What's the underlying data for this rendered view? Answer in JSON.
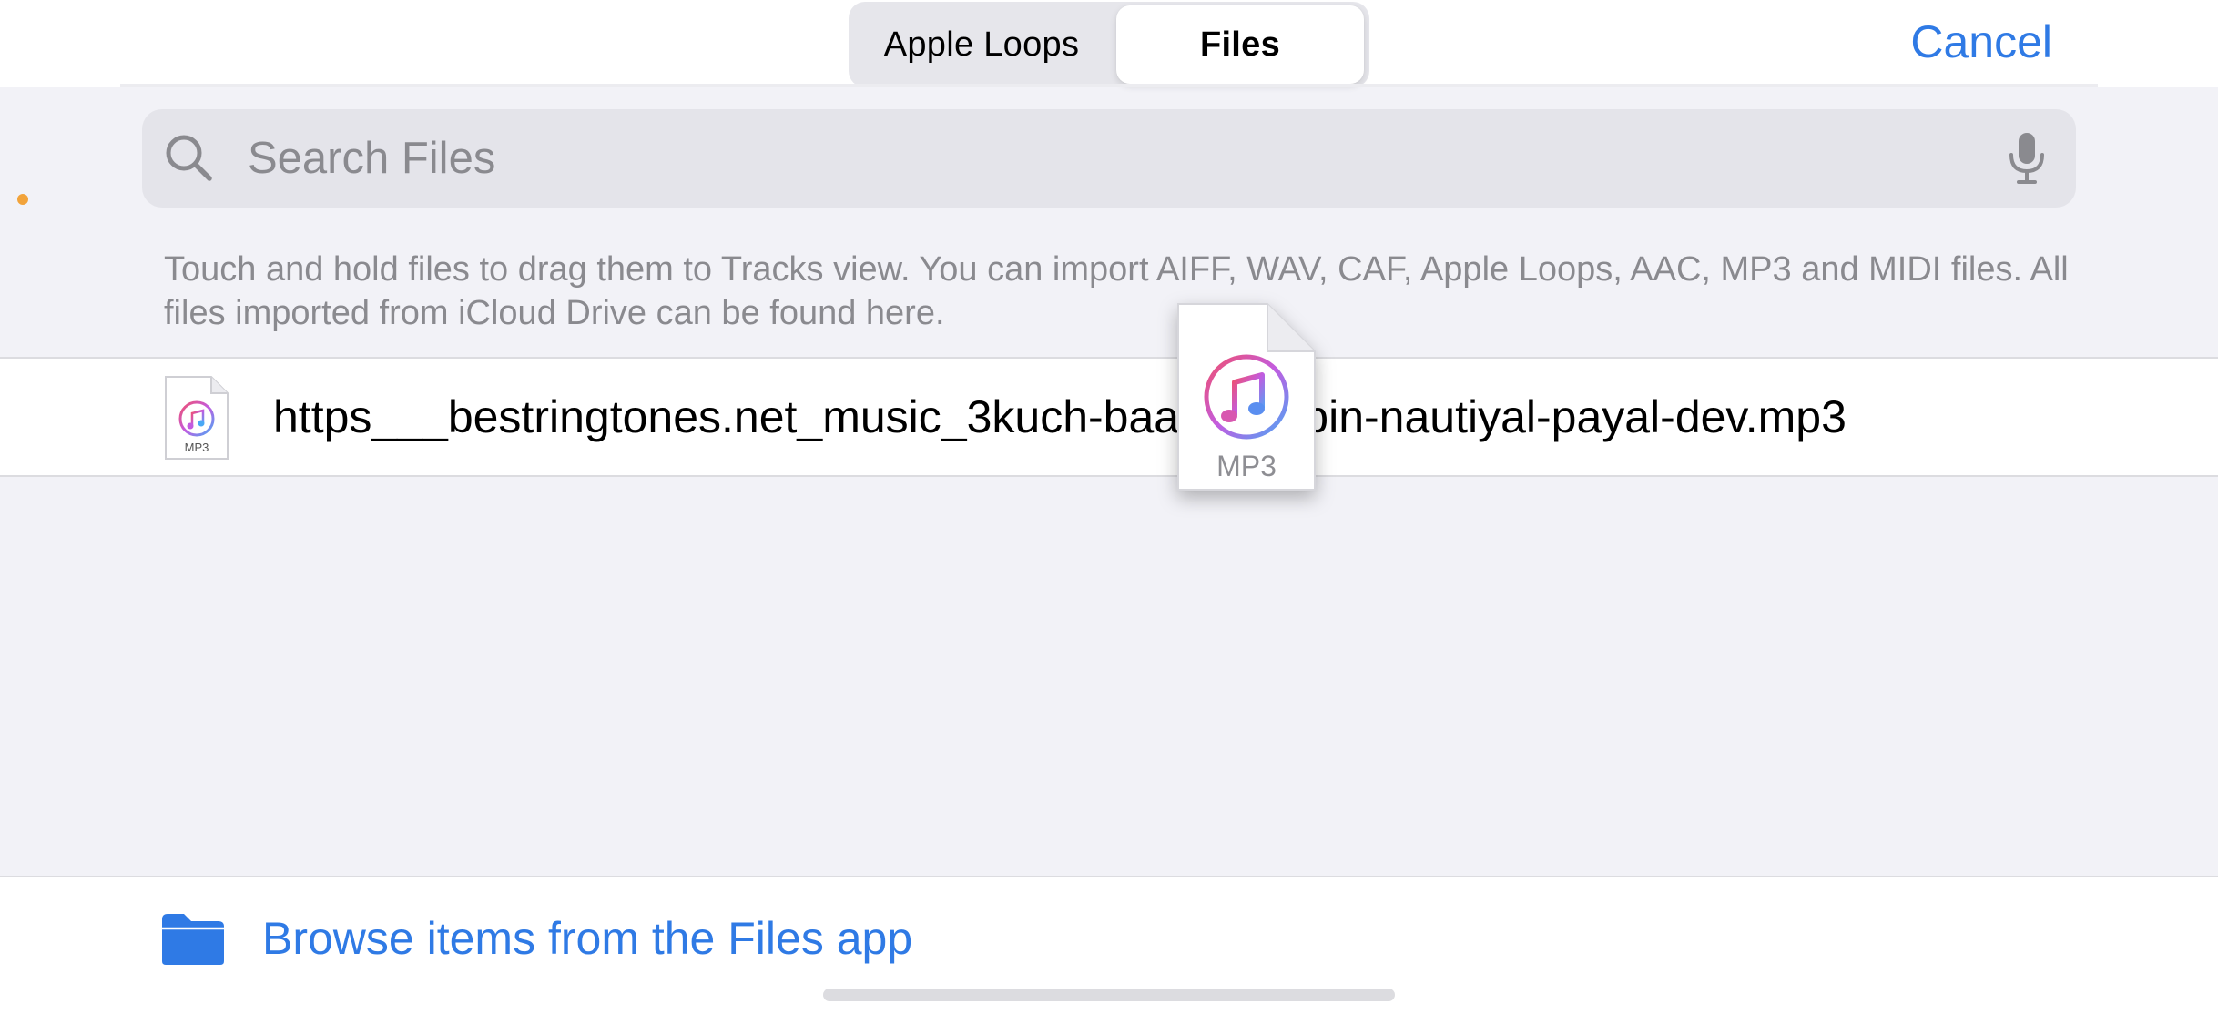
{
  "segmented_control": {
    "options": [
      "Apple Loops",
      "Files"
    ],
    "selected": "Files"
  },
  "header": {
    "cancel_label": "Cancel"
  },
  "search": {
    "placeholder": "Search Files",
    "left_icon": "search-icon",
    "right_icon": "microphone-icon"
  },
  "hint_text": "Touch and hold files to drag them to Tracks view. You can import AIFF, WAV, CAF, Apple Loops, AAC, MP3 and MIDI files. All files imported from iCloud Drive can be found here.",
  "files": [
    {
      "name": "https___bestringtones.net_music_3kuch-baatein-jubin-nautiyal-payal-dev.mp3",
      "type_label": "MP3",
      "icon": "music-note-icon"
    }
  ],
  "drag_preview": {
    "type_label": "MP3",
    "icon": "music-note-icon"
  },
  "footer": {
    "browse_label": "Browse items from the Files app",
    "icon": "folder-icon"
  },
  "colors": {
    "accent": "#2f7ae5",
    "background": "#f2f2f7",
    "status_dot": "#f2a33a"
  }
}
